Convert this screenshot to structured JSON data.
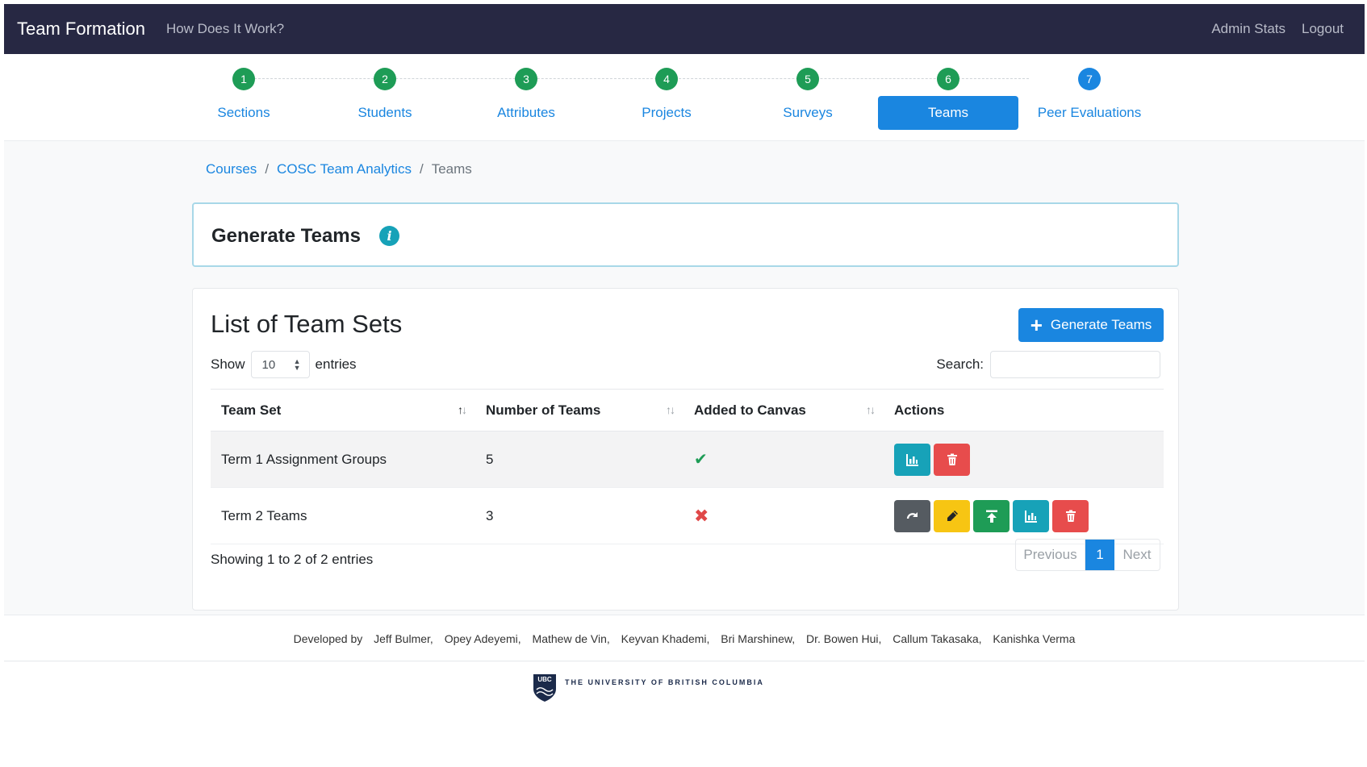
{
  "navbar": {
    "brand": "Team Formation",
    "how": "How Does It Work?",
    "admin_stats": "Admin Stats",
    "logout": "Logout"
  },
  "stepper": [
    {
      "num": "1",
      "label": "Sections"
    },
    {
      "num": "2",
      "label": "Students"
    },
    {
      "num": "3",
      "label": "Attributes"
    },
    {
      "num": "4",
      "label": "Projects"
    },
    {
      "num": "5",
      "label": "Surveys"
    },
    {
      "num": "6",
      "label": "Teams"
    },
    {
      "num": "7",
      "label": "Peer Evaluations"
    }
  ],
  "active_step": "Teams",
  "breadcrumb": {
    "courses": "Courses",
    "course": "COSC Team Analytics",
    "current": "Teams",
    "sep": "/"
  },
  "generate_card": {
    "title": "Generate Teams",
    "info_icon": "i"
  },
  "list": {
    "title": "List of Team Sets",
    "generate_button": "Generate Teams",
    "show_label": "Show",
    "entries_value": "10",
    "entries_label": "entries",
    "search_label": "Search:",
    "search_value": "",
    "columns": [
      "Team Set",
      "Number of Teams",
      "Added to Canvas",
      "Actions"
    ],
    "rows": [
      {
        "team_set": "Term 1 Assignment Groups",
        "num_teams": "5",
        "added_to_canvas": true
      },
      {
        "team_set": "Term 2 Teams",
        "num_teams": "3",
        "added_to_canvas": false
      }
    ],
    "showing": "Showing 1 to 2 of 2 entries",
    "pager": {
      "previous": "Previous",
      "page": "1",
      "next": "Next"
    }
  },
  "footer": {
    "developed_by": "Developed by",
    "developers": [
      "Jeff Bulmer,",
      "Opey Adeyemi,",
      "Mathew de Vin,",
      "Keyvan Khademi,",
      "Bri Marshinew,",
      "Dr. Bowen Hui,",
      "Callum Takasaka,",
      "Kanishka Verma"
    ],
    "university": "THE UNIVERSITY OF BRITISH COLUMBIA",
    "logo_text": "UBC"
  },
  "colors": {
    "navbar": "#272843",
    "primary": "#1a86e0",
    "success": "#1e9c56",
    "info": "#17a2b8",
    "danger": "#e74c4c",
    "warning": "#f7c513"
  }
}
